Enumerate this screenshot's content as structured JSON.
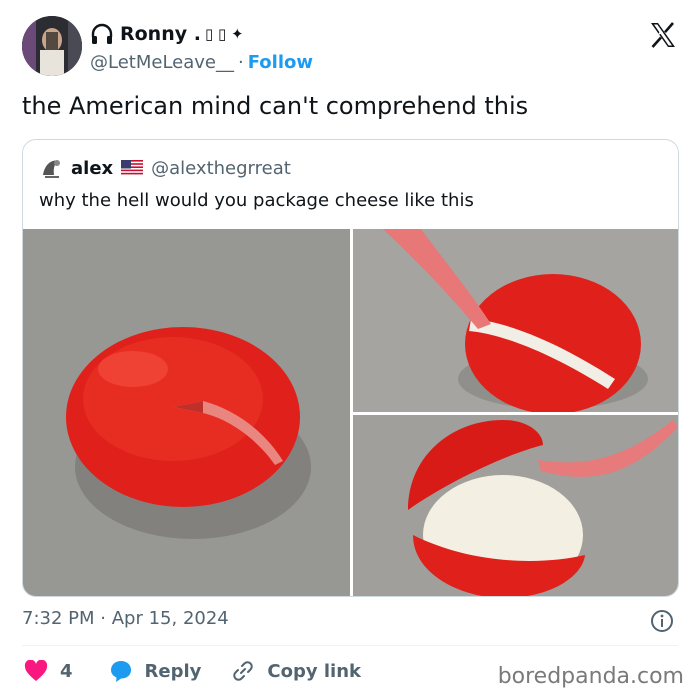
{
  "author": {
    "name": "Ronny .",
    "name_glyphs": "▯ ▯ ✦",
    "handle": "@LetMeLeave__",
    "separator": "·",
    "follow_label": "Follow"
  },
  "tweet": {
    "text": "the American mind can't comprehend this",
    "time": "7:32 PM",
    "date_separator": "·",
    "date": "Apr 15, 2024"
  },
  "quote": {
    "name": "alex",
    "handle": "@alexthegrreat",
    "text": "why the hell would you package cheese like this"
  },
  "actions": {
    "likes_count": "4",
    "reply_label": "Reply",
    "copy_link_label": "Copy link"
  },
  "watermark": "boredpanda.com",
  "colors": {
    "like": "#f91880",
    "reply": "#1d9bf0",
    "follow": "#1d9bf0",
    "muted": "#536471"
  },
  "icons": [
    "headphones-icon",
    "x-logo-icon",
    "us-flag-icon",
    "info-icon",
    "heart-icon",
    "reply-bubble-icon",
    "link-icon"
  ]
}
